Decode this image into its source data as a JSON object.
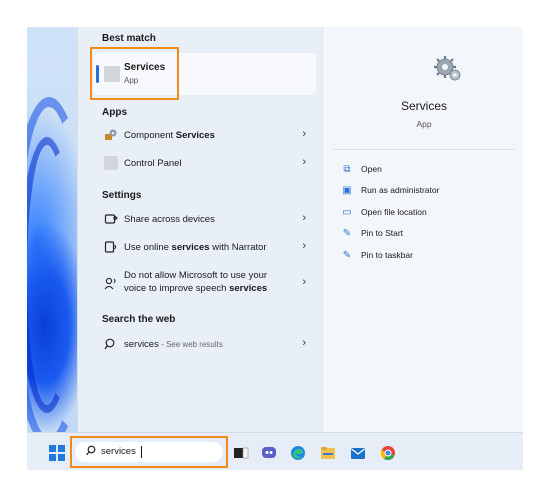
{
  "left_pane": {
    "best_match": {
      "heading": "Best match",
      "name": "Services",
      "subtitle": "App"
    },
    "apps": {
      "heading": "Apps",
      "items": [
        {
          "label_pre": "Component ",
          "label_bold": "Services",
          "icon": "component-services-icon"
        },
        {
          "label": "Control Panel",
          "icon": "control-panel-icon"
        }
      ]
    },
    "settings": {
      "heading": "Settings",
      "items": [
        {
          "label": "Share across devices",
          "icon": "share-devices-icon"
        },
        {
          "label_pre": "Use online ",
          "label_bold": "services",
          "label_post": " with Narrator",
          "icon": "narrator-icon"
        },
        {
          "line1": "Do not allow Microsoft to use your",
          "line2_pre": "voice to improve speech ",
          "line2_bold": "services",
          "icon": "speech-icon"
        }
      ]
    },
    "web": {
      "heading": "Search the web",
      "query": "services",
      "suffix": " - See web results"
    },
    "chevron": "›"
  },
  "right_pane": {
    "title": "Services",
    "subtitle": "App",
    "actions": [
      {
        "label": "Open",
        "icon": "open-icon"
      },
      {
        "label": "Run as administrator",
        "icon": "run-as-admin-icon"
      },
      {
        "label": "Open file location",
        "icon": "folder-icon"
      },
      {
        "label": "Pin to Start",
        "icon": "pin-icon"
      },
      {
        "label": "Pin to taskbar",
        "icon": "pin-icon"
      }
    ]
  },
  "taskbar": {
    "search_value": "services",
    "icons": [
      "windows-start-icon",
      "search-icon",
      "task-view-icon",
      "chat-icon",
      "edge-icon",
      "file-explorer-icon",
      "mail-icon",
      "chrome-icon"
    ]
  },
  "colors": {
    "highlight": "#f08a1c",
    "accent": "#2a6fd6"
  }
}
